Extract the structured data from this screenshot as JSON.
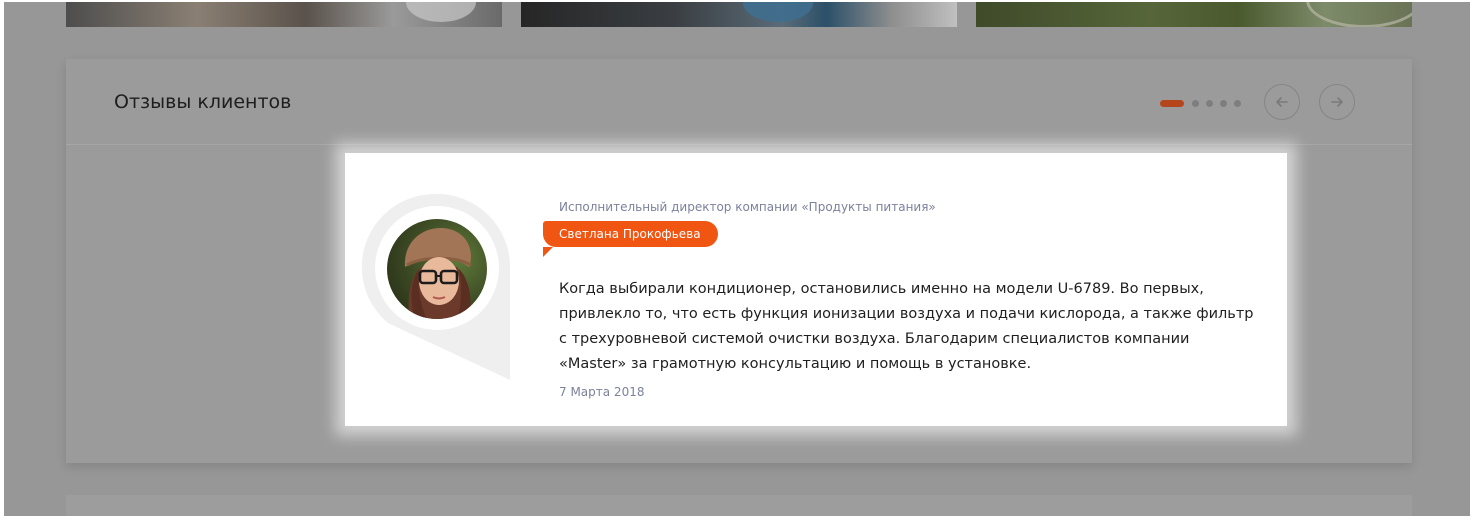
{
  "section": {
    "title": "Отзывы клиентов"
  },
  "carousel": {
    "dots_count": 5,
    "active_dot": 0,
    "prev_icon": "arrow-left-icon",
    "next_icon": "arrow-right-icon"
  },
  "review": {
    "role": "Исполнительный директор компании «Продукты питания»",
    "name": "Светлана Прокофьева",
    "text": "Когда выбирали кондиционер, остановились именно на модели U-6789. Во первых, привлекло то, что есть функция ионизации воздуха и подачи кислорода, а также фильтр с трехуровневой системой очистки воздуха. Благодарим специалистов компании «Master» за грамотную консультацию и помощь в установке.",
    "date": "7 Марта 2018",
    "avatar": "avatar-photo"
  },
  "colors": {
    "accent": "#f15512",
    "meta_text": "#7b829c",
    "overlay": "#979797"
  }
}
